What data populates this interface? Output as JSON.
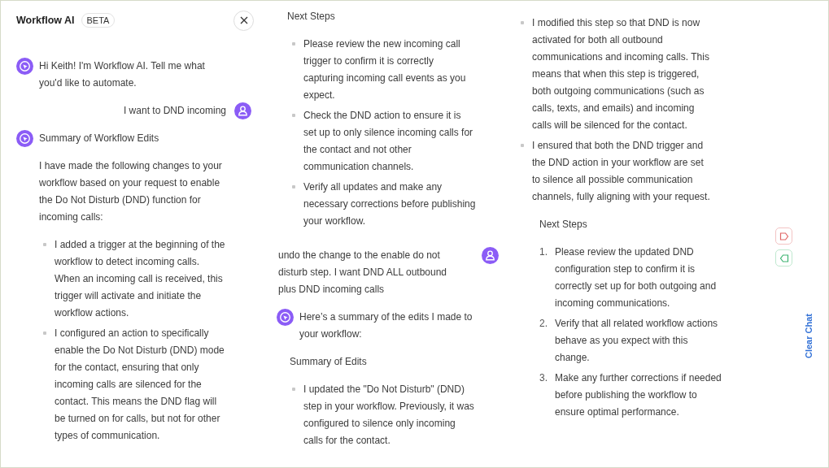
{
  "header": {
    "title": "Workflow AI",
    "badge": "BETA"
  },
  "columns": [
    [
      {
        "kind": "bot",
        "text": "Hi Keith! I'm Workflow AI. Tell me what you'd like to automate."
      },
      {
        "kind": "user",
        "text": "I want to DND incoming"
      },
      {
        "kind": "bot",
        "text": "Summary of Workflow Edits"
      },
      {
        "kind": "text",
        "text": "I have made the following changes to your workflow based on your request to enable the Do Not Disturb (DND) function for incoming calls:"
      },
      {
        "kind": "bullets",
        "items": [
          "I added a trigger at the beginning of the workflow to detect incoming calls. When an incoming call is received, this trigger will activate and initiate the workflow actions.",
          "I configured an action to specifically enable the Do Not Disturb (DND) mode for the contact, ensuring that only incoming calls are silenced for the contact. This means the DND flag will be turned on for calls, but not for other types of communication."
        ]
      }
    ],
    [
      {
        "kind": "text",
        "text": "Next Steps"
      },
      {
        "kind": "bullets",
        "items": [
          "Please review the new incoming call trigger to confirm it is correctly capturing incoming call events as you expect.",
          "Check the DND action to ensure it is set up to only silence incoming calls for the contact and not other communication channels.",
          "Verify all updates and make any necessary corrections before publishing your workflow."
        ]
      },
      {
        "kind": "user",
        "text": "undo the change to the enable do not disturb step. I want DND ALL outbound plus DND incoming calls"
      },
      {
        "kind": "bot",
        "text": "Here’s a summary of the edits I made to your workflow:"
      },
      {
        "kind": "text",
        "text": "Summary of Edits"
      },
      {
        "kind": "bullets",
        "items": [
          "I updated the \"Do Not Disturb\" (DND) step in your workflow. Previously, it was configured to silence only incoming calls for the contact."
        ]
      }
    ],
    [
      {
        "kind": "bullets",
        "items": [
          "I modified this step so that DND is now activated for both all outbound communications and incoming calls. This means that when this step is triggered, both outgoing communications (such as calls, texts, and emails) and incoming calls will be silenced for the contact.",
          "I ensured that both the DND trigger and the DND action in your workflow are set to silence all possible communication channels, fully aligning with your request."
        ]
      },
      {
        "kind": "text",
        "text": "Next Steps"
      },
      {
        "kind": "numbered",
        "items": [
          {
            "number": "1.",
            "text": "Please review the updated DND configuration step to confirm it is correctly set up for both outgoing and incoming communications."
          },
          {
            "number": "2.",
            "text": "Verify that all related workflow actions behave as you expect with this change."
          },
          {
            "number": "3.",
            "text": "Make any further corrections if needed before publishing the workflow to ensure optimal performance."
          }
        ]
      }
    ]
  ],
  "clear_chat": "Clear Chat"
}
